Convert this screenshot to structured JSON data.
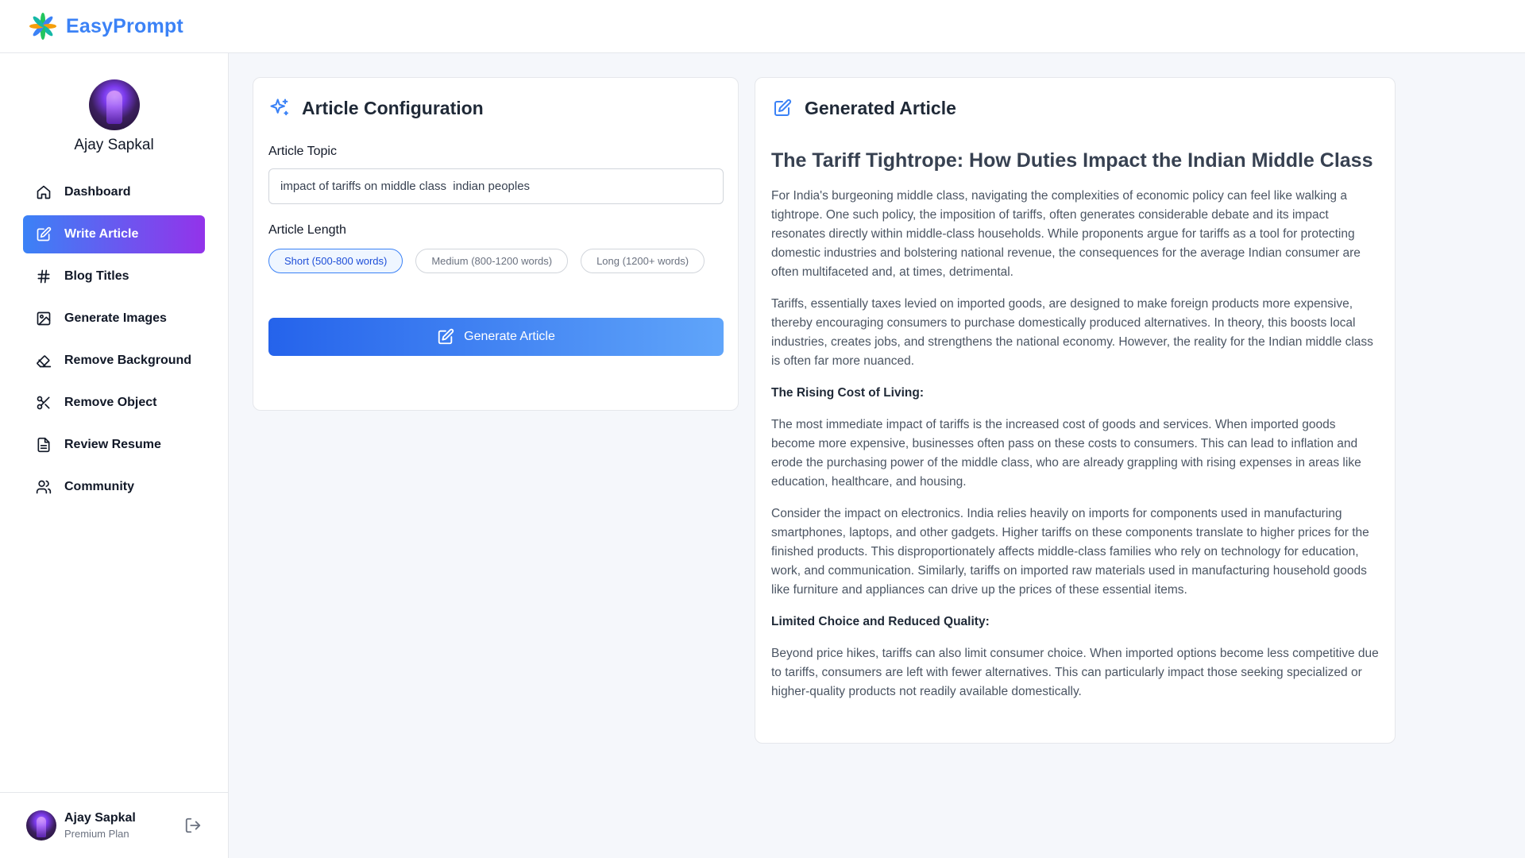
{
  "app": {
    "name": "EasyPrompt"
  },
  "colors": {
    "accent": "#3b82f6",
    "active_nav_gradient": [
      "#3b82f6",
      "#9333ea"
    ],
    "button_gradient": [
      "#2563eb",
      "#60a5fa"
    ]
  },
  "user": {
    "name": "Ajay Sapkal",
    "plan": "Premium Plan"
  },
  "sidebar": {
    "items": [
      {
        "label": "Dashboard",
        "icon": "home-icon"
      },
      {
        "label": "Write Article",
        "icon": "edit-icon",
        "active": true
      },
      {
        "label": "Blog Titles",
        "icon": "hash-icon"
      },
      {
        "label": "Generate Images",
        "icon": "image-icon"
      },
      {
        "label": "Remove Background",
        "icon": "eraser-icon"
      },
      {
        "label": "Remove Object",
        "icon": "scissors-icon"
      },
      {
        "label": "Review Resume",
        "icon": "file-text-icon"
      },
      {
        "label": "Community",
        "icon": "users-icon"
      }
    ]
  },
  "config": {
    "title": "Article Configuration",
    "topic_label": "Article Topic",
    "topic_value": "impact of tariffs on middle class  indian peoples",
    "length_label": "Article Length",
    "length_options": [
      {
        "label": "Short (500-800 words)",
        "selected": true
      },
      {
        "label": "Medium (800-1200 words)",
        "selected": false
      },
      {
        "label": "Long (1200+ words)",
        "selected": false
      }
    ],
    "generate_label": "Generate Article"
  },
  "article": {
    "panel_title": "Generated Article",
    "heading": "The Tariff Tightrope: How Duties Impact the Indian Middle Class",
    "blocks": [
      {
        "type": "p",
        "text": "For India's burgeoning middle class, navigating the complexities of economic policy can feel like walking a tightrope. One such policy, the imposition of tariffs, often generates considerable debate and its impact resonates directly within middle-class households. While proponents argue for tariffs as a tool for protecting domestic industries and bolstering national revenue, the consequences for the average Indian consumer are often multifaceted and, at times, detrimental."
      },
      {
        "type": "p",
        "text": "Tariffs, essentially taxes levied on imported goods, are designed to make foreign products more expensive, thereby encouraging consumers to purchase domestically produced alternatives. In theory, this boosts local industries, creates jobs, and strengthens the national economy. However, the reality for the Indian middle class is often far more nuanced."
      },
      {
        "type": "h",
        "text": "The Rising Cost of Living:"
      },
      {
        "type": "p",
        "text": "The most immediate impact of tariffs is the increased cost of goods and services. When imported goods become more expensive, businesses often pass on these costs to consumers. This can lead to inflation and erode the purchasing power of the middle class, who are already grappling with rising expenses in areas like education, healthcare, and housing."
      },
      {
        "type": "p",
        "text": "Consider the impact on electronics. India relies heavily on imports for components used in manufacturing smartphones, laptops, and other gadgets. Higher tariffs on these components translate to higher prices for the finished products. This disproportionately affects middle-class families who rely on technology for education, work, and communication. Similarly, tariffs on imported raw materials used in manufacturing household goods like furniture and appliances can drive up the prices of these essential items."
      },
      {
        "type": "h",
        "text": "Limited Choice and Reduced Quality:"
      },
      {
        "type": "p",
        "text": "Beyond price hikes, tariffs can also limit consumer choice. When imported options become less competitive due to tariffs, consumers are left with fewer alternatives. This can particularly impact those seeking specialized or higher-quality products not readily available domestically."
      }
    ]
  }
}
